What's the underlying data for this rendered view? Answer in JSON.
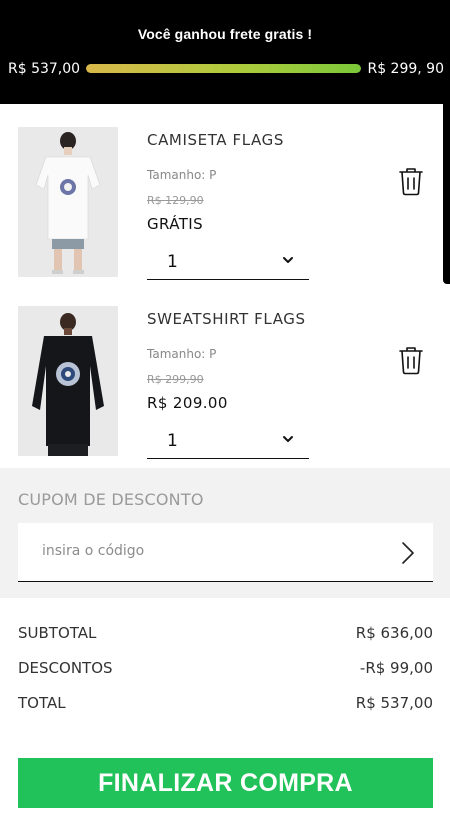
{
  "banner": {
    "title": "Você ganhou frete gratis !",
    "left_value": "R$ 537,00",
    "right_value": "R$ 299, 90",
    "progress": 1.0
  },
  "items": [
    {
      "name": "CAMISETA FLAGS",
      "size": "Tamanho: P",
      "old_price": "R$ 129,90",
      "price": "GRÁTIS",
      "quantity": "1",
      "image": "white-tshirt-model"
    },
    {
      "name": "SWEATSHIRT FLAGS",
      "size": "Tamanho: P",
      "old_price": "R$ 299,90",
      "price": "R$ 209.00",
      "quantity": "1",
      "image": "black-sweatshirt-model"
    }
  ],
  "coupon": {
    "title": "CUPOM DE DESCONTO",
    "placeholder": "insira o código",
    "value": ""
  },
  "totals": {
    "subtotal_label": "SUBTOTAL",
    "subtotal_value": "R$ 636,00",
    "discounts_label": "DESCONTOS",
    "discounts_value": "-R$ 99,00",
    "total_label": "TOTAL",
    "total_value": "R$ 537,00"
  },
  "cta_label": "FINALIZAR COMPRA",
  "colors": {
    "banner_bg": "#000000",
    "cta_green": "#22c25a",
    "progress_start": "#d9b84a",
    "progress_end": "#7bc83a"
  },
  "icons": {
    "trash": "trash-icon",
    "chevron": "chevron-down-icon",
    "arrow": "chevron-right-icon"
  }
}
